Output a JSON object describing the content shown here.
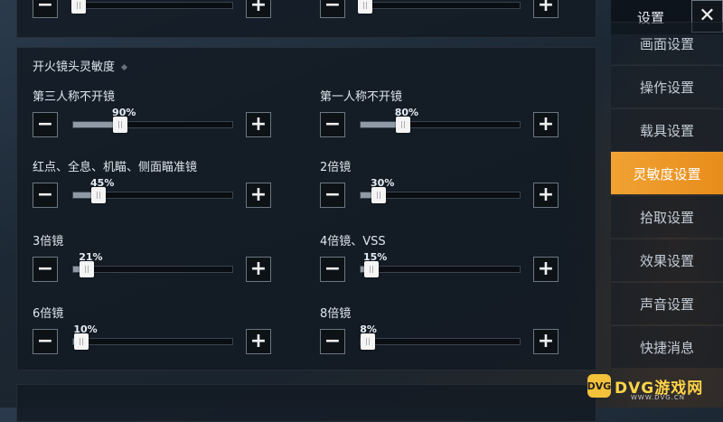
{
  "colors": {
    "accent": "#e88d1b",
    "panel": "#121a22",
    "fill": "#8f9aa6",
    "watermark": "#ffd449"
  },
  "top_partial": [
    {
      "id": "top-left",
      "fill_fraction": 0.04
    },
    {
      "id": "top-right",
      "fill_fraction": 0.02
    }
  ],
  "section": {
    "title": "开火镜头灵敏度"
  },
  "sliders": [
    {
      "label": "第三人称不开镜",
      "value": "90%",
      "fraction": 0.9
    },
    {
      "label": "第一人称不开镜",
      "value": "80%",
      "fraction": 0.8
    },
    {
      "label": "红点、全息、机瞄、侧面瞄准镜",
      "value": "45%",
      "fraction": 0.45
    },
    {
      "label": "2倍镜",
      "value": "30%",
      "fraction": 0.3
    },
    {
      "label": "3倍镜",
      "value": "21%",
      "fraction": 0.21
    },
    {
      "label": "4倍镜、VSS",
      "value": "15%",
      "fraction": 0.15
    },
    {
      "label": "6倍镜",
      "value": "10%",
      "fraction": 0.1
    },
    {
      "label": "8倍镜",
      "value": "8%",
      "fraction": 0.08
    }
  ],
  "menu": {
    "title": "设置",
    "close_icon": "✕",
    "items": [
      {
        "label": "画面设置",
        "active": false
      },
      {
        "label": "操作设置",
        "active": false
      },
      {
        "label": "载具设置",
        "active": false
      },
      {
        "label": "灵敏度设置",
        "active": true
      },
      {
        "label": "拾取设置",
        "active": false
      },
      {
        "label": "效果设置",
        "active": false
      },
      {
        "label": "声音设置",
        "active": false
      },
      {
        "label": "快捷消息",
        "active": false
      }
    ]
  },
  "watermark": {
    "logo": "DVG",
    "name": "DVG游戏网",
    "url": "WWW.DVG.CN"
  },
  "icons": {
    "minus": "−",
    "plus": "+"
  }
}
